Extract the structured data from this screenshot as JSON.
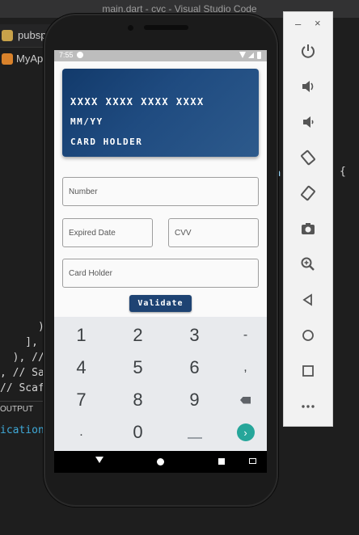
{
  "vscode": {
    "title": "main.dart - cvc - Visual Studio Code",
    "tab1": "pubsp",
    "tab2": "MyAp",
    "code_lines": [
      {
        "text": "      ),"
      },
      {
        "text": "    ], //"
      },
      {
        "text": "  ), //"
      },
      {
        "text": ", // Sa"
      },
      {
        "text": "// Scaf"
      }
    ],
    "output_label": "OUTPUT",
    "output_text": "ication",
    "right_brace": "{",
    "mark_a": "a"
  },
  "phone": {
    "status_time": "7:55",
    "card": {
      "number": "XXXX XXXX XXXX XXXX",
      "expiry": "MM/YY",
      "holder": "CARD HOLDER"
    },
    "fields": {
      "number": "Number",
      "expired": "Expired Date",
      "cvv": "CVV",
      "holder": "Card Holder"
    },
    "validate_label": "Validate",
    "keyboard": {
      "row1": [
        "1",
        "2",
        "3",
        "-"
      ],
      "row2": [
        "4",
        "5",
        "6",
        ","
      ],
      "row3": [
        "7",
        "8",
        "9"
      ],
      "row4": [
        ".",
        "0"
      ]
    }
  },
  "emulator": {
    "minimize": "–",
    "close": "×",
    "buttons": [
      "power-icon",
      "volume-up-icon",
      "volume-down-icon",
      "rotate-left-icon",
      "rotate-right-icon",
      "camera-icon",
      "zoom-icon",
      "back-icon",
      "home-icon",
      "overview-icon",
      "more-icon"
    ]
  }
}
